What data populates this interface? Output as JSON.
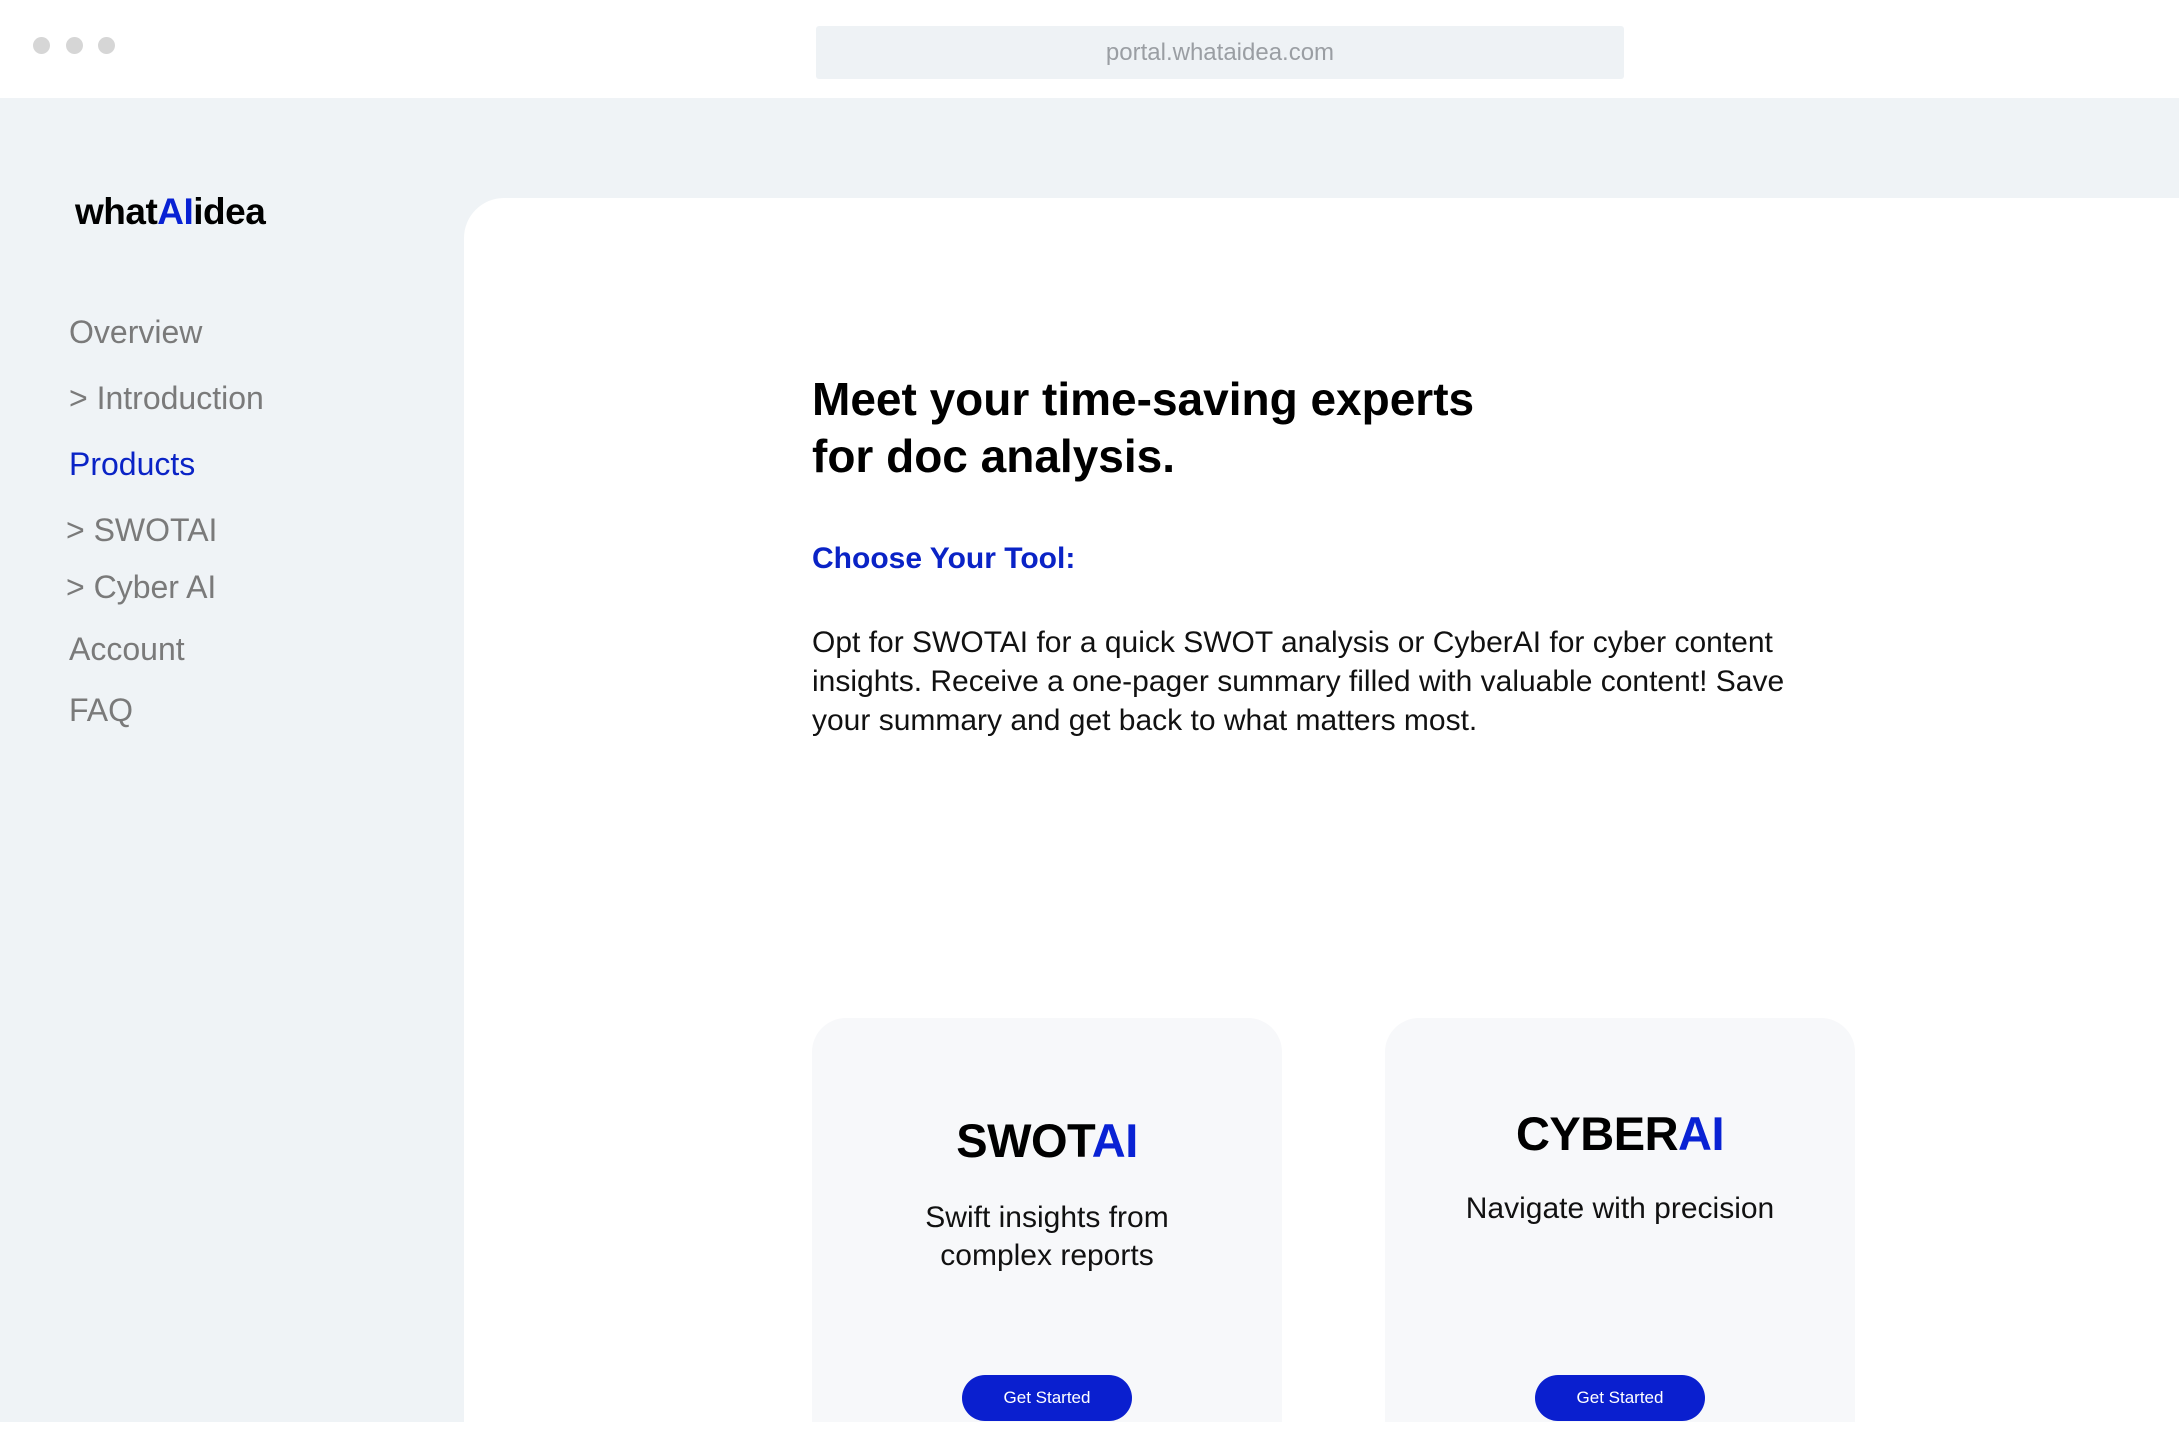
{
  "browser": {
    "url": "portal.whataidea.com"
  },
  "sidebar": {
    "logo": {
      "part1": "what",
      "accent": "AI",
      "part2": "idea"
    },
    "items": [
      {
        "label": "Overview"
      },
      {
        "label": "> Introduction"
      },
      {
        "label": "Products"
      },
      {
        "label": "> SWOTAI"
      },
      {
        "label": "> Cyber AI"
      },
      {
        "label": "Account"
      },
      {
        "label": "FAQ"
      }
    ]
  },
  "main": {
    "headline_line1": "Meet your time-saving experts",
    "headline_line2": "for doc analysis.",
    "choose_label": "Choose Your Tool:",
    "description": "Opt for SWOTAI for a quick SWOT analysis or CyberAI for cyber content insights. Receive a one-pager summary filled with valuable content! Save your summary and get back to what matters most.",
    "cards": [
      {
        "title": "SWOT",
        "title_accent": "AI",
        "subtitle_line1": "Swift insights from",
        "subtitle_line2": "complex reports",
        "button": "Get Started"
      },
      {
        "title": "CYBER",
        "title_accent": "AI",
        "subtitle_line1": "Navigate with precision",
        "subtitle_line2": "",
        "button": "Get Started"
      }
    ]
  },
  "colors": {
    "accent": "#0a23c6",
    "sidebar_bg": "#eff3f6",
    "nav_text": "#7a7a7a"
  }
}
